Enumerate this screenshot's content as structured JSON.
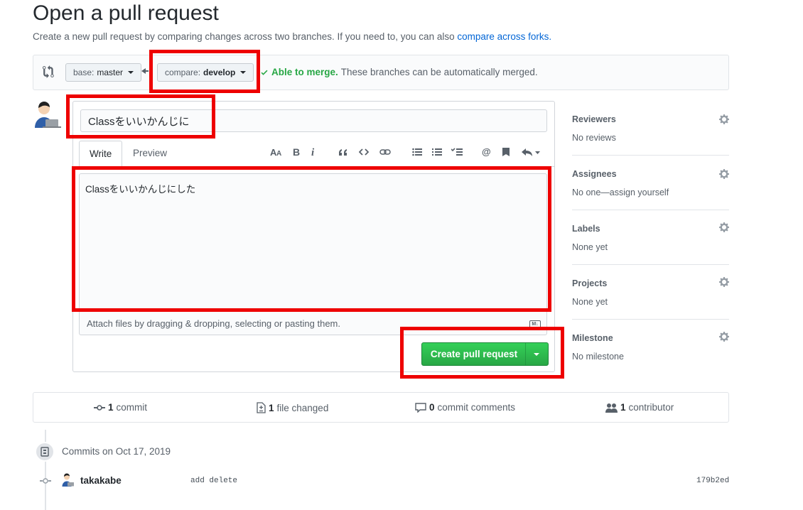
{
  "page": {
    "title": "Open a pull request",
    "subtitle": "Create a new pull request by comparing changes across two branches. If you need to, you can also ",
    "subtitle_link": "compare across forks.",
    "accent_color": "#0366d6"
  },
  "range": {
    "base_prefix": "base:",
    "base_branch": "master",
    "compare_prefix": "compare:",
    "compare_branch": "develop",
    "merge_ok_label": "Able to merge.",
    "merge_msg": "These branches can be automatically merged.",
    "status_color": "#28a745"
  },
  "editor": {
    "title_value": "Classをいいかんじに",
    "tabs": [
      "Write",
      "Preview"
    ],
    "toolbar": [
      "text-size-icon",
      "bold-icon",
      "italic-icon",
      "quote-icon",
      "code-icon",
      "link-icon",
      "unordered-list-icon",
      "ordered-list-icon",
      "task-list-icon",
      "mention-icon",
      "saved-reply-icon",
      "reply-icon"
    ],
    "body_value": "Classをいいかんじにした",
    "attach_hint": "Attach files by dragging & dropping, selecting or pasting them.",
    "submit_label": "Create pull request"
  },
  "sidebar": {
    "sections": [
      {
        "title": "Reviewers",
        "value": "No reviews"
      },
      {
        "title": "Assignees",
        "value": "No one—assign yourself"
      },
      {
        "title": "Labels",
        "value": "None yet"
      },
      {
        "title": "Projects",
        "value": "None yet"
      },
      {
        "title": "Milestone",
        "value": "No milestone"
      }
    ]
  },
  "summary": {
    "commits_count": "1",
    "commits_label": "commit",
    "files_count": "1",
    "files_label": "file changed",
    "comments_count": "0",
    "comments_label": "commit comments",
    "contributors_count": "1",
    "contributors_label": "contributor"
  },
  "commits": {
    "date_label": "Commits on Oct 17, 2019",
    "items": [
      {
        "author": "takakabe",
        "message": "add delete",
        "sha": "179b2ed"
      }
    ]
  },
  "highlight_color": "#ee0000"
}
